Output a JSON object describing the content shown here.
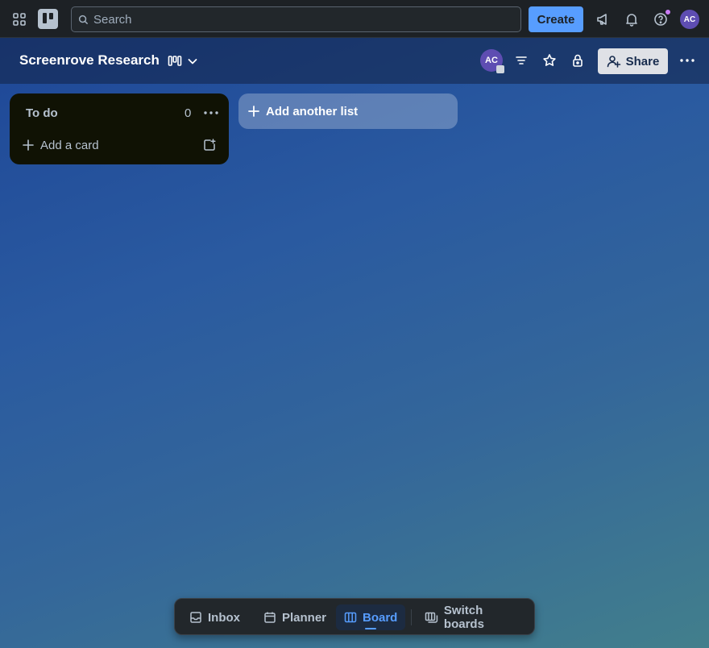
{
  "topbar": {
    "search_placeholder": "Search",
    "create_label": "Create",
    "avatar_initials": "AC"
  },
  "board": {
    "title": "Screenrove Research",
    "member_initials": "AC",
    "share_label": "Share"
  },
  "lists": [
    {
      "title": "To do",
      "count": "0",
      "add_card_label": "Add a card"
    }
  ],
  "add_list_label": "Add another list",
  "bottom_nav": {
    "inbox": "Inbox",
    "planner": "Planner",
    "board": "Board",
    "switch_boards": "Switch boards"
  },
  "colors": {
    "accent": "#579dff",
    "topbar": "#1d2125",
    "list_bg": "#101204",
    "avatar": "#5e4db2"
  }
}
